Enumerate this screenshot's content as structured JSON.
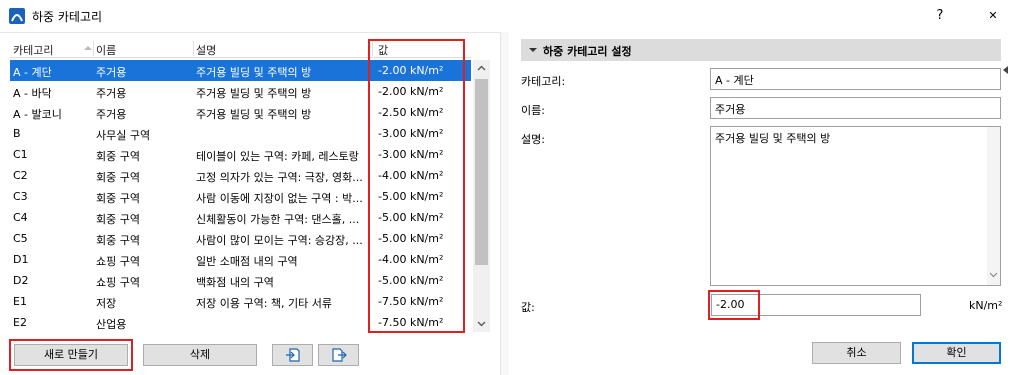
{
  "window": {
    "title": "하중 카테고리",
    "help": "?",
    "close": "✕"
  },
  "table": {
    "headers": {
      "category": "카테고리",
      "name": "이름",
      "description": "설명",
      "value": "값"
    },
    "rows": [
      {
        "category": "A - 계단",
        "name": "주거용",
        "description": "주거용 빌딩 및 주택의 방",
        "value": "-2.00 kN/m²",
        "selected": true
      },
      {
        "category": "A - 바닥",
        "name": "주거용",
        "description": "주거용 빌딩 및 주택의 방",
        "value": "-2.00 kN/m²"
      },
      {
        "category": "A - 발코니",
        "name": "주거용",
        "description": "주거용 빌딩 및 주택의 방",
        "value": "-2.50 kN/m²"
      },
      {
        "category": "B",
        "name": "사무실 구역",
        "description": "",
        "value": "-3.00 kN/m²"
      },
      {
        "category": "C1",
        "name": "회중 구역",
        "description": "테이블이 있는 구역: 카페, 레스토랑",
        "value": "-3.00 kN/m²"
      },
      {
        "category": "C2",
        "name": "회중 구역",
        "description": "고정 의자가 있는 구역: 극장, 영화...",
        "value": "-4.00 kN/m²"
      },
      {
        "category": "C3",
        "name": "회중 구역",
        "description": "사람 이동에 지장이 없는 구역 : 박...",
        "value": "-5.00 kN/m²"
      },
      {
        "category": "C4",
        "name": "회중 구역",
        "description": "신체활동이 가능한 구역: 댄스홀, ...",
        "value": "-5.00 kN/m²"
      },
      {
        "category": "C5",
        "name": "회중 구역",
        "description": "사람이 많이 모이는 구역: 승강장, ...",
        "value": "-5.00 kN/m²"
      },
      {
        "category": "D1",
        "name": "쇼핑 구역",
        "description": "일반 소매점 내의 구역",
        "value": "-4.00 kN/m²"
      },
      {
        "category": "D2",
        "name": "쇼핑 구역",
        "description": "백화점 내의 구역",
        "value": "-5.00 kN/m²"
      },
      {
        "category": "E1",
        "name": "저장",
        "description": "저장 이용 구역: 책, 기타 서류",
        "value": "-7.50 kN/m²"
      },
      {
        "category": "E2",
        "name": "산업용",
        "description": "",
        "value": "-7.50 kN/m²"
      }
    ]
  },
  "buttons": {
    "new": "새로 만들기",
    "delete": "삭제",
    "cancel": "취소",
    "ok": "확인"
  },
  "settings": {
    "section_title": "하중 카테고리 설정",
    "category_label": "카테고리:",
    "category_value": "A - 계단",
    "name_label": "이름:",
    "name_value": "주거용",
    "description_label": "설명:",
    "description_value": "주거용 빌딩 및 주택의 방",
    "value_label": "값:",
    "value_value": "-2.00",
    "unit": "kN/m²"
  },
  "colors": {
    "selection": "#1a73d9",
    "highlight": "#e02020",
    "section_bg": "#dcdcdc",
    "ok_border": "#0078d7"
  }
}
